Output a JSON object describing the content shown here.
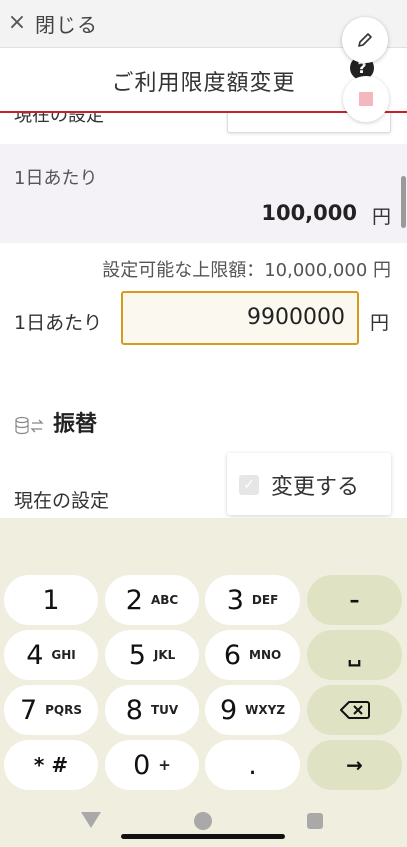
{
  "topbar": {
    "close_icon": "×",
    "close_label": "閉じる"
  },
  "header": {
    "title": "ご利用限度額変更",
    "help_icon": "?"
  },
  "content": {
    "cut_label": "現在の設定",
    "current": {
      "label": "1日あたり",
      "amount": "100,000",
      "unit": "円"
    },
    "limit_note": "設定可能な上限額：10,000,000 円",
    "input": {
      "label": "1日あたり",
      "value": "9900000",
      "unit": "円"
    },
    "transfer": {
      "title": "振替"
    },
    "current2_label": "現在の設定",
    "change": {
      "label": "変更する",
      "checked": false
    }
  },
  "keyboard": {
    "keys": [
      {
        "main": "1",
        "sub": ""
      },
      {
        "main": "2",
        "sub": "ABC"
      },
      {
        "main": "3",
        "sub": "DEF"
      },
      {
        "main": "–",
        "sub": ""
      },
      {
        "main": "4",
        "sub": "GHI"
      },
      {
        "main": "5",
        "sub": "JKL"
      },
      {
        "main": "6",
        "sub": "MNO"
      },
      {
        "main": "␣",
        "sub": ""
      },
      {
        "main": "7",
        "sub": "PQRS"
      },
      {
        "main": "8",
        "sub": "TUV"
      },
      {
        "main": "9",
        "sub": "WXYZ"
      },
      {
        "main": "⌫",
        "sub": ""
      },
      {
        "main": "* #",
        "sub": ""
      },
      {
        "main": "0",
        "sub": "+"
      },
      {
        "main": ".",
        "sub": ""
      },
      {
        "main": "→",
        "sub": ""
      }
    ]
  },
  "colors": {
    "accent_red": "#c8202a",
    "input_border": "#d89a1a",
    "keyboard_bg": "#f0eedf",
    "fn_key_bg": "#dfe3c4"
  }
}
